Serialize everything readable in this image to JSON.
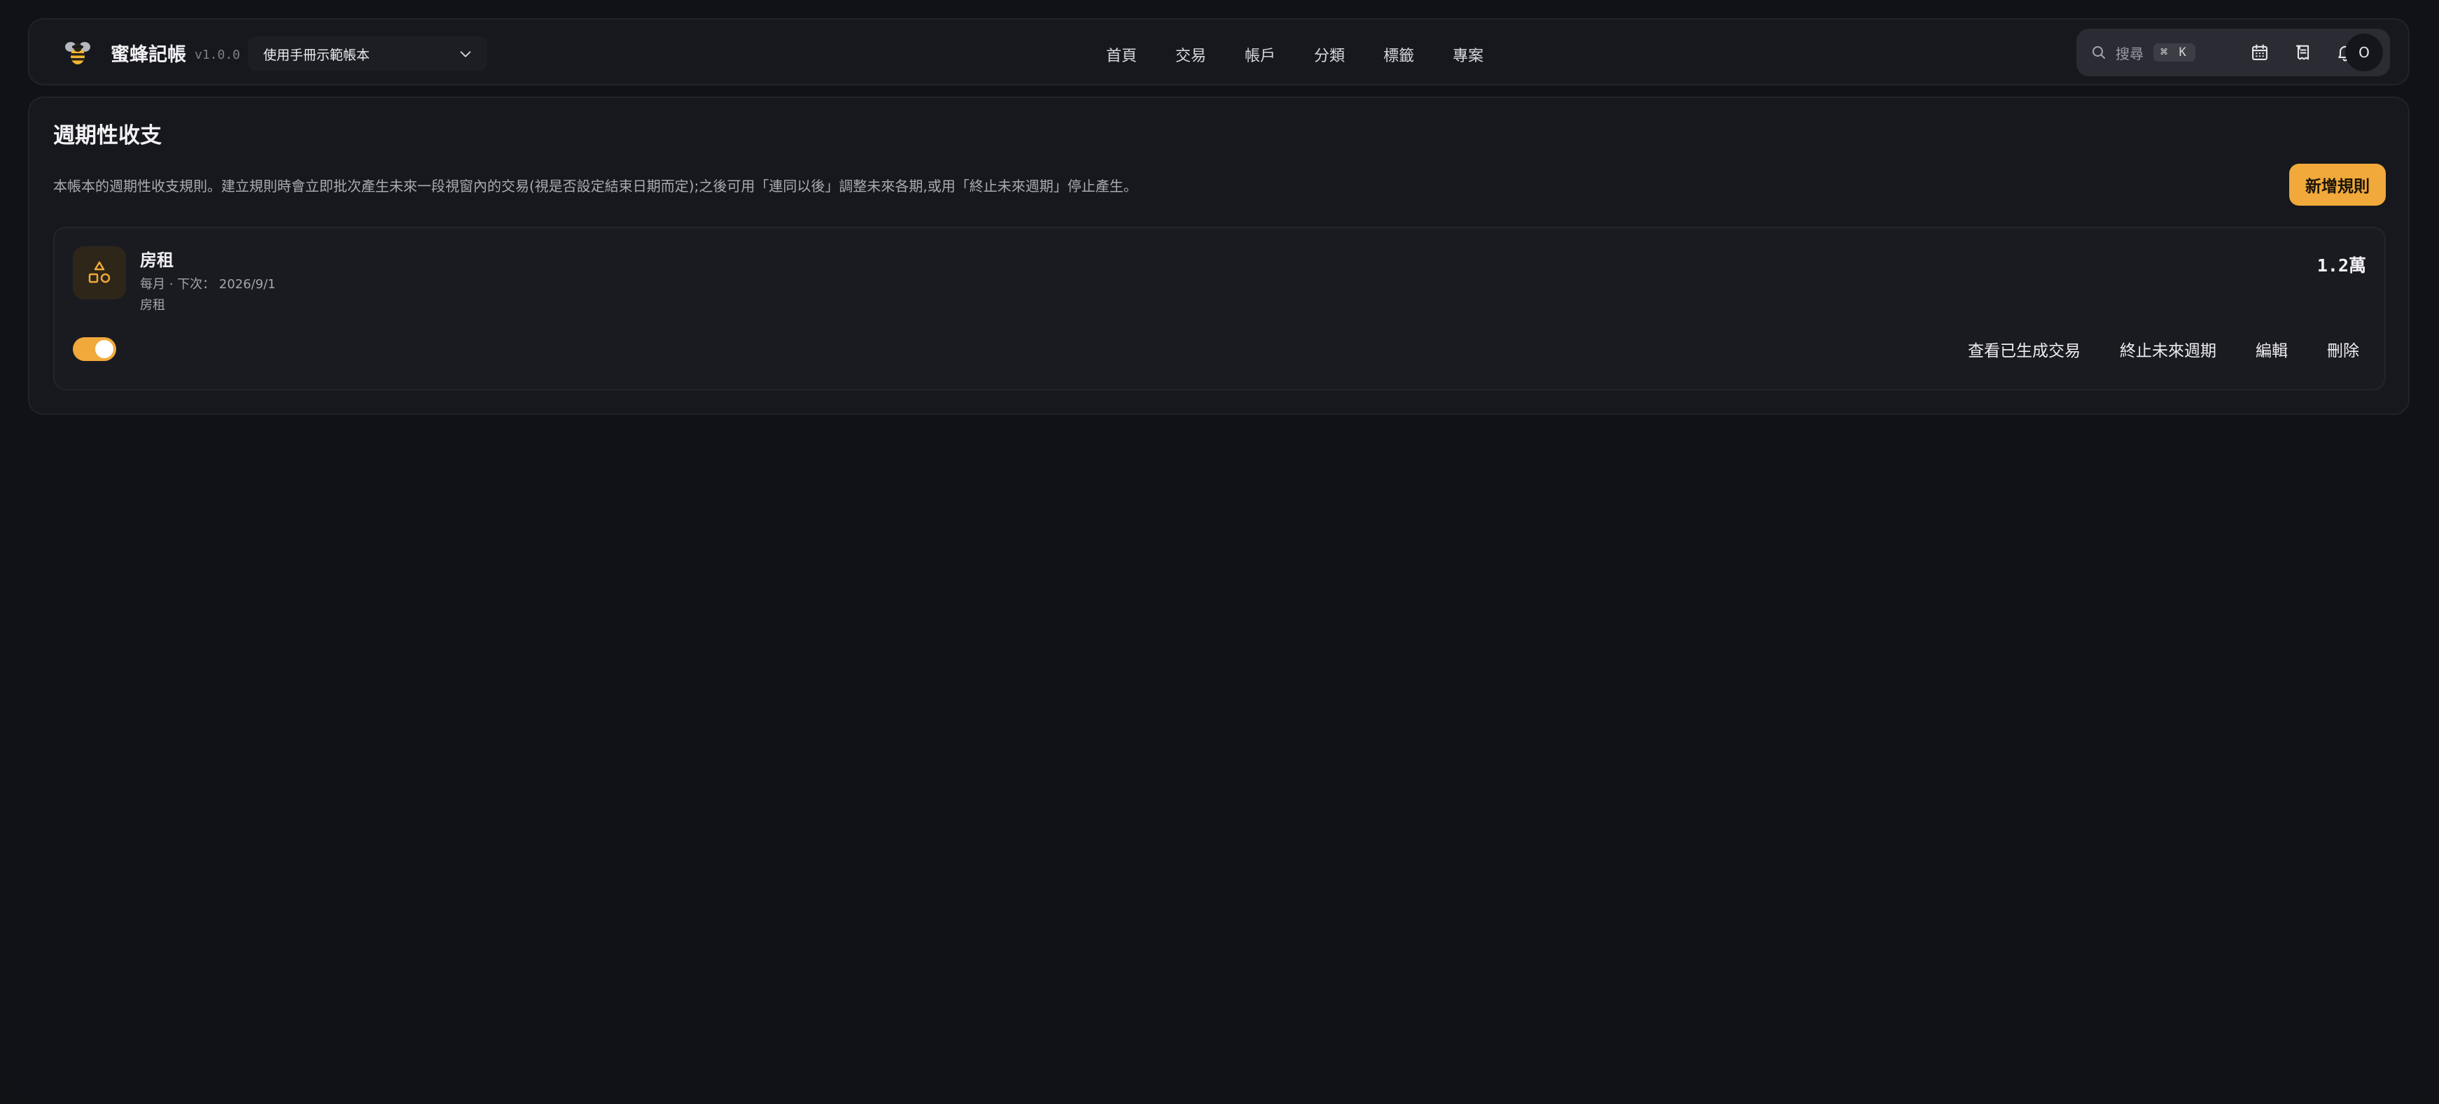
{
  "app": {
    "name": "蜜蜂記帳",
    "version": "v1.0.0",
    "book_selector": {
      "selected": "使用手冊示範帳本"
    }
  },
  "nav": {
    "items": [
      {
        "label": "首頁"
      },
      {
        "label": "交易"
      },
      {
        "label": "帳戶"
      },
      {
        "label": "分類"
      },
      {
        "label": "標籤"
      },
      {
        "label": "專案"
      }
    ]
  },
  "toolbar": {
    "search_label": "搜尋",
    "search_shortcut": "⌘ K",
    "avatar_initial": "O",
    "icons": [
      "search-icon",
      "calendar-icon",
      "receipt-icon",
      "bell-icon"
    ]
  },
  "page": {
    "title": "週期性收支",
    "description": "本帳本的週期性收支規則。建立規則時會立即批次產生未來一段視窗內的交易(視是否設定結束日期而定);之後可用「連同以後」調整未來各期,或用「終止未來週期」停止產生。",
    "add_button": "新增規則"
  },
  "rules": [
    {
      "name": "房租",
      "meta": "每月 · 下次： 2026/9/1",
      "category": "房租",
      "amount": "1.2萬",
      "enabled": true,
      "icon": "shapes-icon",
      "actions": {
        "view": "查看已生成交易",
        "stop": "終止未來週期",
        "edit": "編輯",
        "delete": "刪除"
      }
    }
  ],
  "colors": {
    "accent": "#f0a93a",
    "background": "#111217",
    "surface": "#17181d"
  }
}
